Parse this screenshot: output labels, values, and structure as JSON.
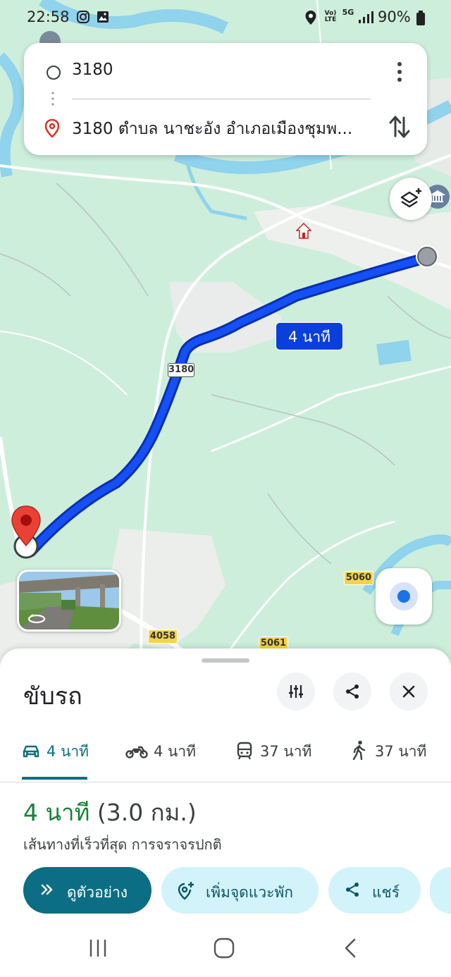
{
  "status_bar": {
    "time": "22:58",
    "network": "5G",
    "volte": "Vo) LTE",
    "battery": "90%",
    "icons": [
      "instagram-icon",
      "gallery-icon",
      "location-icon",
      "signal-icon",
      "battery-icon"
    ]
  },
  "search": {
    "origin": "3180",
    "destination": "3180 ตำบล นาชะอัง อำเภอเมืองชุมพ..."
  },
  "map": {
    "duration_label": "4 นาที",
    "road_badges": [
      "3180",
      "5060",
      "4058",
      "5061"
    ],
    "route_color": "#0b3fdc",
    "marker_color": "#d93025"
  },
  "sheet": {
    "title": "ขับรถ",
    "modes": [
      {
        "icon": "car-icon",
        "label": "4 นาที",
        "active": true
      },
      {
        "icon": "motorcycle-icon",
        "label": "4 นาที",
        "active": false
      },
      {
        "icon": "transit-icon",
        "label": "37 นาที",
        "active": false
      },
      {
        "icon": "walk-icon",
        "label": "37 นาที",
        "active": false
      }
    ],
    "summary_time": "4 นาที",
    "summary_distance": "(3.0 กม.)",
    "route_description": "เส้นทางที่เร็วที่สุด การจราจรปกติ",
    "actions": {
      "preview": "ดูตัวอย่าง",
      "add_stop": "เพิ่มจุดแวะพัก",
      "share": "แชร์"
    }
  },
  "colors": {
    "accent": "#0b6e84",
    "time_green": "#188038",
    "chip_bg": "#d3f3fb"
  }
}
